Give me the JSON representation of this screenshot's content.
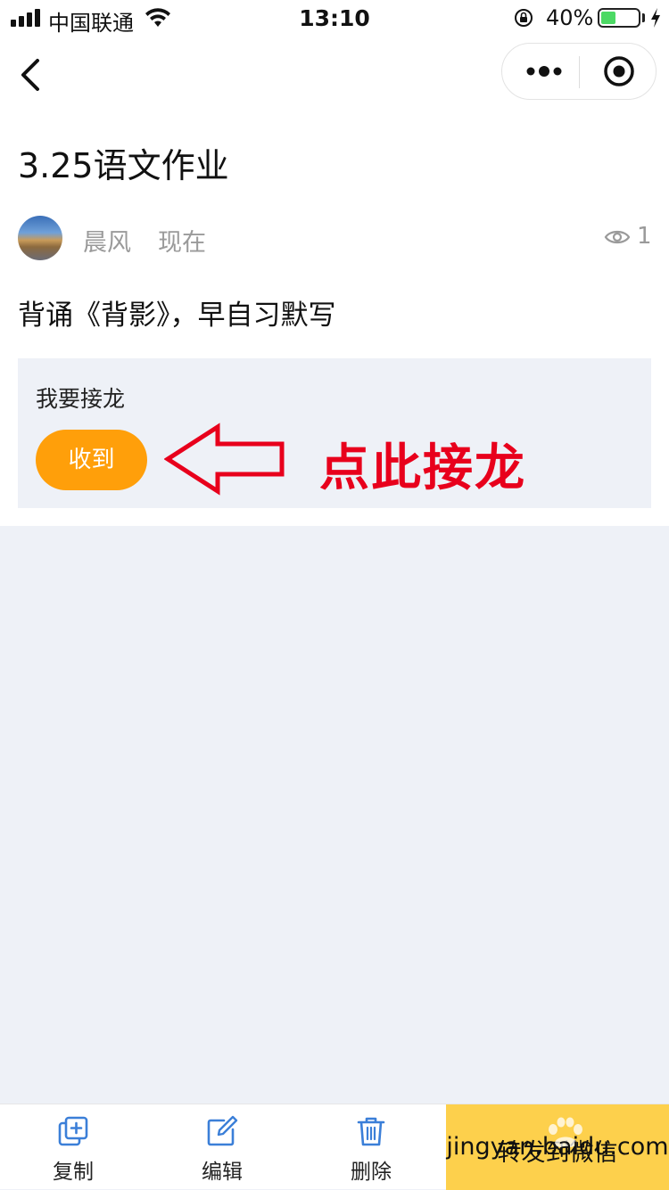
{
  "status_bar": {
    "carrier": "中国联通",
    "time": "13:10",
    "battery_text": "40%",
    "battery_level": 0.4
  },
  "nav": {
    "back_icon": "chevron-left-icon",
    "more_icon": "more-dots-icon",
    "close_icon": "target-circle-icon"
  },
  "post": {
    "title": "3.25语文作业",
    "author": "晨风",
    "time": "现在",
    "view_count": "1",
    "content": "背诵《背影》，早自习默写"
  },
  "jielong": {
    "label": "我要接龙",
    "button_label": "收到",
    "annotation": "点此接龙"
  },
  "toolbar": {
    "copy_label": "复制",
    "edit_label": "编辑",
    "delete_label": "删除",
    "forward_label": "转发到微信"
  },
  "watermark": {
    "text": "jingyan.baidu.com"
  },
  "colors": {
    "accent_orange": "#ff9f0a",
    "forward_yellow": "#fdd04c",
    "annotation_red": "#e8001c",
    "icon_blue": "#3b7fd8",
    "background_gray": "#eef1f7"
  }
}
